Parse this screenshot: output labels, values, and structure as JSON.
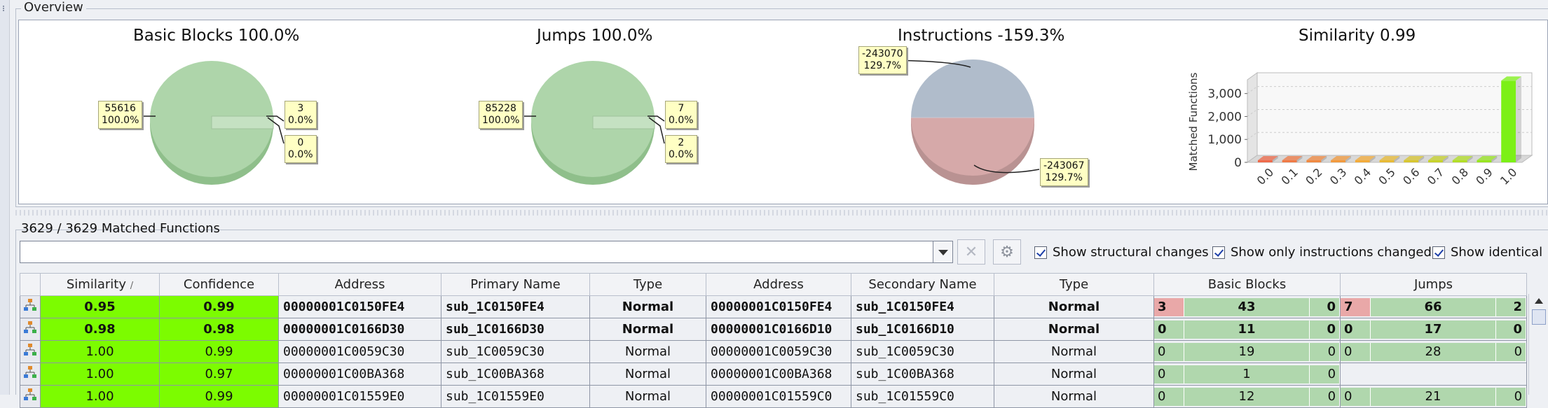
{
  "overview": {
    "section_title": "Overview",
    "charts": [
      {
        "title": "Basic Blocks 100.0%",
        "callouts": [
          [
            "55616",
            "100.0%"
          ],
          [
            "3",
            "0.0%"
          ],
          [
            "0",
            "0.0%"
          ]
        ]
      },
      {
        "title": "Jumps 100.0%",
        "callouts": [
          [
            "85228",
            "100.0%"
          ],
          [
            "7",
            "0.0%"
          ],
          [
            "2",
            "0.0%"
          ]
        ]
      },
      {
        "title": "Instructions -159.3%",
        "callouts": [
          [
            "-243070",
            "129.7%"
          ],
          [
            "-243067",
            "129.7%"
          ]
        ]
      },
      {
        "title": "Similarity 0.99"
      }
    ],
    "pie_colors": {
      "green": "#a8d3a5",
      "green_edge": "#8fbf8b",
      "blue": "#b0bccb",
      "red": "#d2a6a6"
    }
  },
  "chart_data": {
    "type": "bar",
    "title": "Similarity 0.99",
    "ylabel": "Matched Functions",
    "xlabel": "",
    "categories": [
      "0.0",
      "0.1",
      "0.2",
      "0.3",
      "0.4",
      "0.5",
      "0.6",
      "0.7",
      "0.8",
      "0.9",
      "1.0"
    ],
    "values": [
      0,
      0,
      0,
      0,
      0,
      0,
      0,
      0,
      0,
      40,
      3560
    ],
    "ylim": [
      0,
      3600
    ],
    "yticks": [
      "0",
      "1,000",
      "2,000",
      "3,000"
    ],
    "grid": true,
    "colors": [
      "#ee6a4a",
      "#ef7a46",
      "#f08a42",
      "#f29a3e",
      "#f3ab3a",
      "#e8bb35",
      "#d8c630",
      "#c7d22b",
      "#b2de26",
      "#98e520",
      "#7cf016"
    ]
  },
  "matched": {
    "title": "3629 / 3629 Matched Functions",
    "filter_value": "",
    "clear_icon": "clear-x-icon",
    "settings_icon": "gear-icon",
    "checkboxes": [
      {
        "label": "Show structural changes",
        "checked": true
      },
      {
        "label": "Show only instructions changed",
        "checked": true
      },
      {
        "label": "Show identical",
        "checked": true
      }
    ],
    "columns": [
      "Similarity",
      "Confidence",
      "Address",
      "Primary Name",
      "Type",
      "Address",
      "Secondary Name",
      "Type",
      "Basic Blocks",
      "Jumps"
    ],
    "sort_indicator": "/",
    "rows": [
      {
        "bold": true,
        "sim": "0.95",
        "conf": "0.99",
        "addr1": "00000001C0150FE4",
        "name1": "sub_1C0150FE4",
        "type1": "Normal",
        "addr2": "00000001C0150FE4",
        "name2": "sub_1C0150FE4",
        "type2": "Normal",
        "bb": [
          "3",
          "43",
          "0"
        ],
        "jumps": [
          "7",
          "66",
          "2"
        ]
      },
      {
        "bold": true,
        "sim": "0.98",
        "conf": "0.98",
        "addr1": "00000001C0166D30",
        "name1": "sub_1C0166D30",
        "type1": "Normal",
        "addr2": "00000001C0166D10",
        "name2": "sub_1C0166D10",
        "type2": "Normal",
        "bb": [
          "0",
          "11",
          "0"
        ],
        "jumps": [
          "0",
          "17",
          "0"
        ]
      },
      {
        "bold": false,
        "sim": "1.00",
        "conf": "0.99",
        "addr1": "00000001C0059C30",
        "name1": "sub_1C0059C30",
        "type1": "Normal",
        "addr2": "00000001C0059C30",
        "name2": "sub_1C0059C30",
        "type2": "Normal",
        "bb": [
          "0",
          "19",
          "0"
        ],
        "jumps": [
          "0",
          "28",
          "0"
        ]
      },
      {
        "bold": false,
        "sim": "1.00",
        "conf": "0.97",
        "addr1": "00000001C00BA368",
        "name1": "sub_1C00BA368",
        "type1": "Normal",
        "addr2": "00000001C00BA368",
        "name2": "sub_1C00BA368",
        "type2": "Normal",
        "bb": [
          "0",
          "1",
          "0"
        ],
        "jumps": []
      },
      {
        "bold": false,
        "sim": "1.00",
        "conf": "0.99",
        "addr1": "00000001C01559E0",
        "name1": "sub_1C01559E0",
        "type1": "Normal",
        "addr2": "00000001C01559C0",
        "name2": "sub_1C01559C0",
        "type2": "Normal",
        "bb": [
          "0",
          "12",
          "0"
        ],
        "jumps": [
          "0",
          "21",
          "0"
        ]
      }
    ]
  }
}
